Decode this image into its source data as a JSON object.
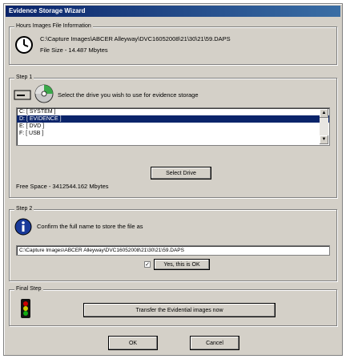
{
  "window": {
    "title": "Evidence Storage Wizard"
  },
  "hours_info": {
    "legend": "Hours Images File Information",
    "path": "C:\\Capture Images\\ABCER Alleyway\\DVC16052008\\21\\30\\21\\59.DAPS",
    "file_size": "File Size - 14.487 Mbytes"
  },
  "step1": {
    "legend": "Step 1",
    "instruction": "Select the drive you wish to use for evidence storage",
    "drives": [
      {
        "label": "C:  [ SYSTEM ]",
        "selected": false
      },
      {
        "label": "D:  [ EVIDENCE ]",
        "selected": true
      },
      {
        "label": "E:  [ DVD ]",
        "selected": false
      },
      {
        "label": "F:  [ USB ]",
        "selected": false
      }
    ],
    "select_button": "Select Drive",
    "free_space": "Free Space - 3412544.162 Mbytes"
  },
  "step2": {
    "legend": "Step 2",
    "instruction": "Confirm the full name to store the file as",
    "file_name": "C:\\Capture Images\\ABCER Alleyway\\DVC16052008\\21\\30\\21\\59.DAPS",
    "confirm_checkbox_checked": true,
    "confirm_label": "Yes, this is OK"
  },
  "final_step": {
    "legend": "Final Step",
    "transfer_button": "Transfer the Evidential images now"
  },
  "buttons": {
    "ok": "OK",
    "cancel": "Cancel"
  },
  "icons": {
    "clock": "clock-icon",
    "drive": "drive-icon",
    "cd": "cd-icon",
    "info": "info-icon",
    "traffic_light": "traffic-light-icon"
  },
  "colors": {
    "titlebar_start": "#0a246a",
    "titlebar_end": "#3a6ea5",
    "selection": "#0a246a",
    "face": "#d4d0c8"
  }
}
